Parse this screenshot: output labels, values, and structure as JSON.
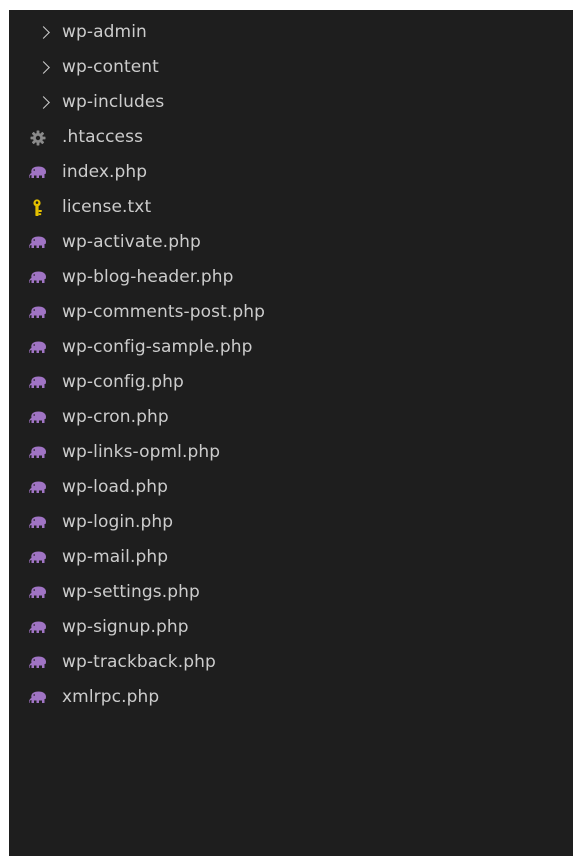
{
  "explorer": {
    "folders": [
      {
        "label": "wp-admin",
        "icon": "chevron-right-icon"
      },
      {
        "label": "wp-content",
        "icon": "chevron-right-icon"
      },
      {
        "label": "wp-includes",
        "icon": "chevron-right-icon"
      }
    ],
    "files": [
      {
        "label": ".htaccess",
        "icon": "gear-icon"
      },
      {
        "label": "index.php",
        "icon": "php-elephant-icon"
      },
      {
        "label": "license.txt",
        "icon": "license-key-icon"
      },
      {
        "label": "wp-activate.php",
        "icon": "php-elephant-icon"
      },
      {
        "label": "wp-blog-header.php",
        "icon": "php-elephant-icon"
      },
      {
        "label": "wp-comments-post.php",
        "icon": "php-elephant-icon"
      },
      {
        "label": "wp-config-sample.php",
        "icon": "php-elephant-icon"
      },
      {
        "label": "wp-config.php",
        "icon": "php-elephant-icon"
      },
      {
        "label": "wp-cron.php",
        "icon": "php-elephant-icon"
      },
      {
        "label": "wp-links-opml.php",
        "icon": "php-elephant-icon"
      },
      {
        "label": "wp-load.php",
        "icon": "php-elephant-icon"
      },
      {
        "label": "wp-login.php",
        "icon": "php-elephant-icon"
      },
      {
        "label": "wp-mail.php",
        "icon": "php-elephant-icon"
      },
      {
        "label": "wp-settings.php",
        "icon": "php-elephant-icon"
      },
      {
        "label": "wp-signup.php",
        "icon": "php-elephant-icon"
      },
      {
        "label": "wp-trackback.php",
        "icon": "php-elephant-icon"
      },
      {
        "label": "xmlrpc.php",
        "icon": "php-elephant-icon"
      }
    ]
  },
  "colors": {
    "background": "#1e1e1e",
    "text": "#cccccc",
    "php_icon": "#a074c4",
    "gear_icon": "#8a8a8a",
    "key_icon": "#e5c100"
  }
}
